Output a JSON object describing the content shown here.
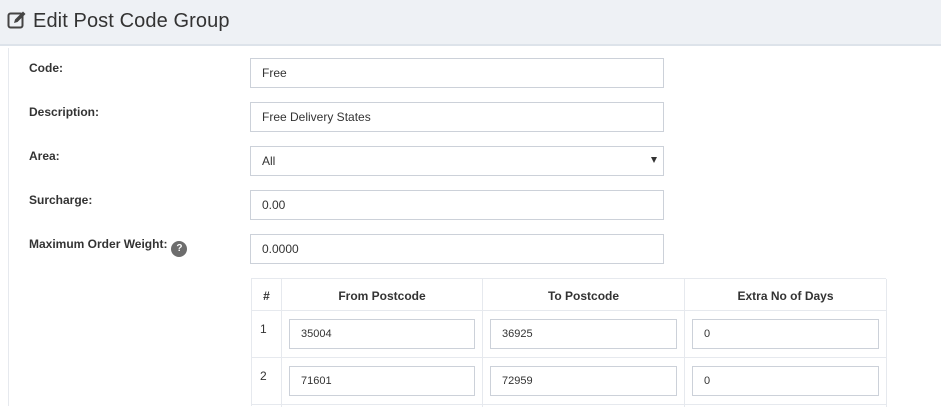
{
  "header": {
    "title": "Edit Post Code Group",
    "icon": "edit-icon"
  },
  "form": {
    "code_label": "Code:",
    "code_value": "Free",
    "description_label": "Description:",
    "description_value": "Free Delivery States",
    "area_label": "Area:",
    "area_value": "All",
    "surcharge_label": "Surcharge:",
    "surcharge_value": "0.00",
    "max_weight_label": "Maximum Order Weight:",
    "max_weight_help": "?",
    "max_weight_value": "0.0000"
  },
  "table": {
    "headers": [
      "#",
      "From Postcode",
      "To Postcode",
      "Extra No of Days"
    ],
    "rows": [
      {
        "num": "1",
        "from": "35004",
        "to": "36925",
        "days": "0"
      },
      {
        "num": "2",
        "from": "71601",
        "to": "72959",
        "days": "0"
      }
    ]
  }
}
